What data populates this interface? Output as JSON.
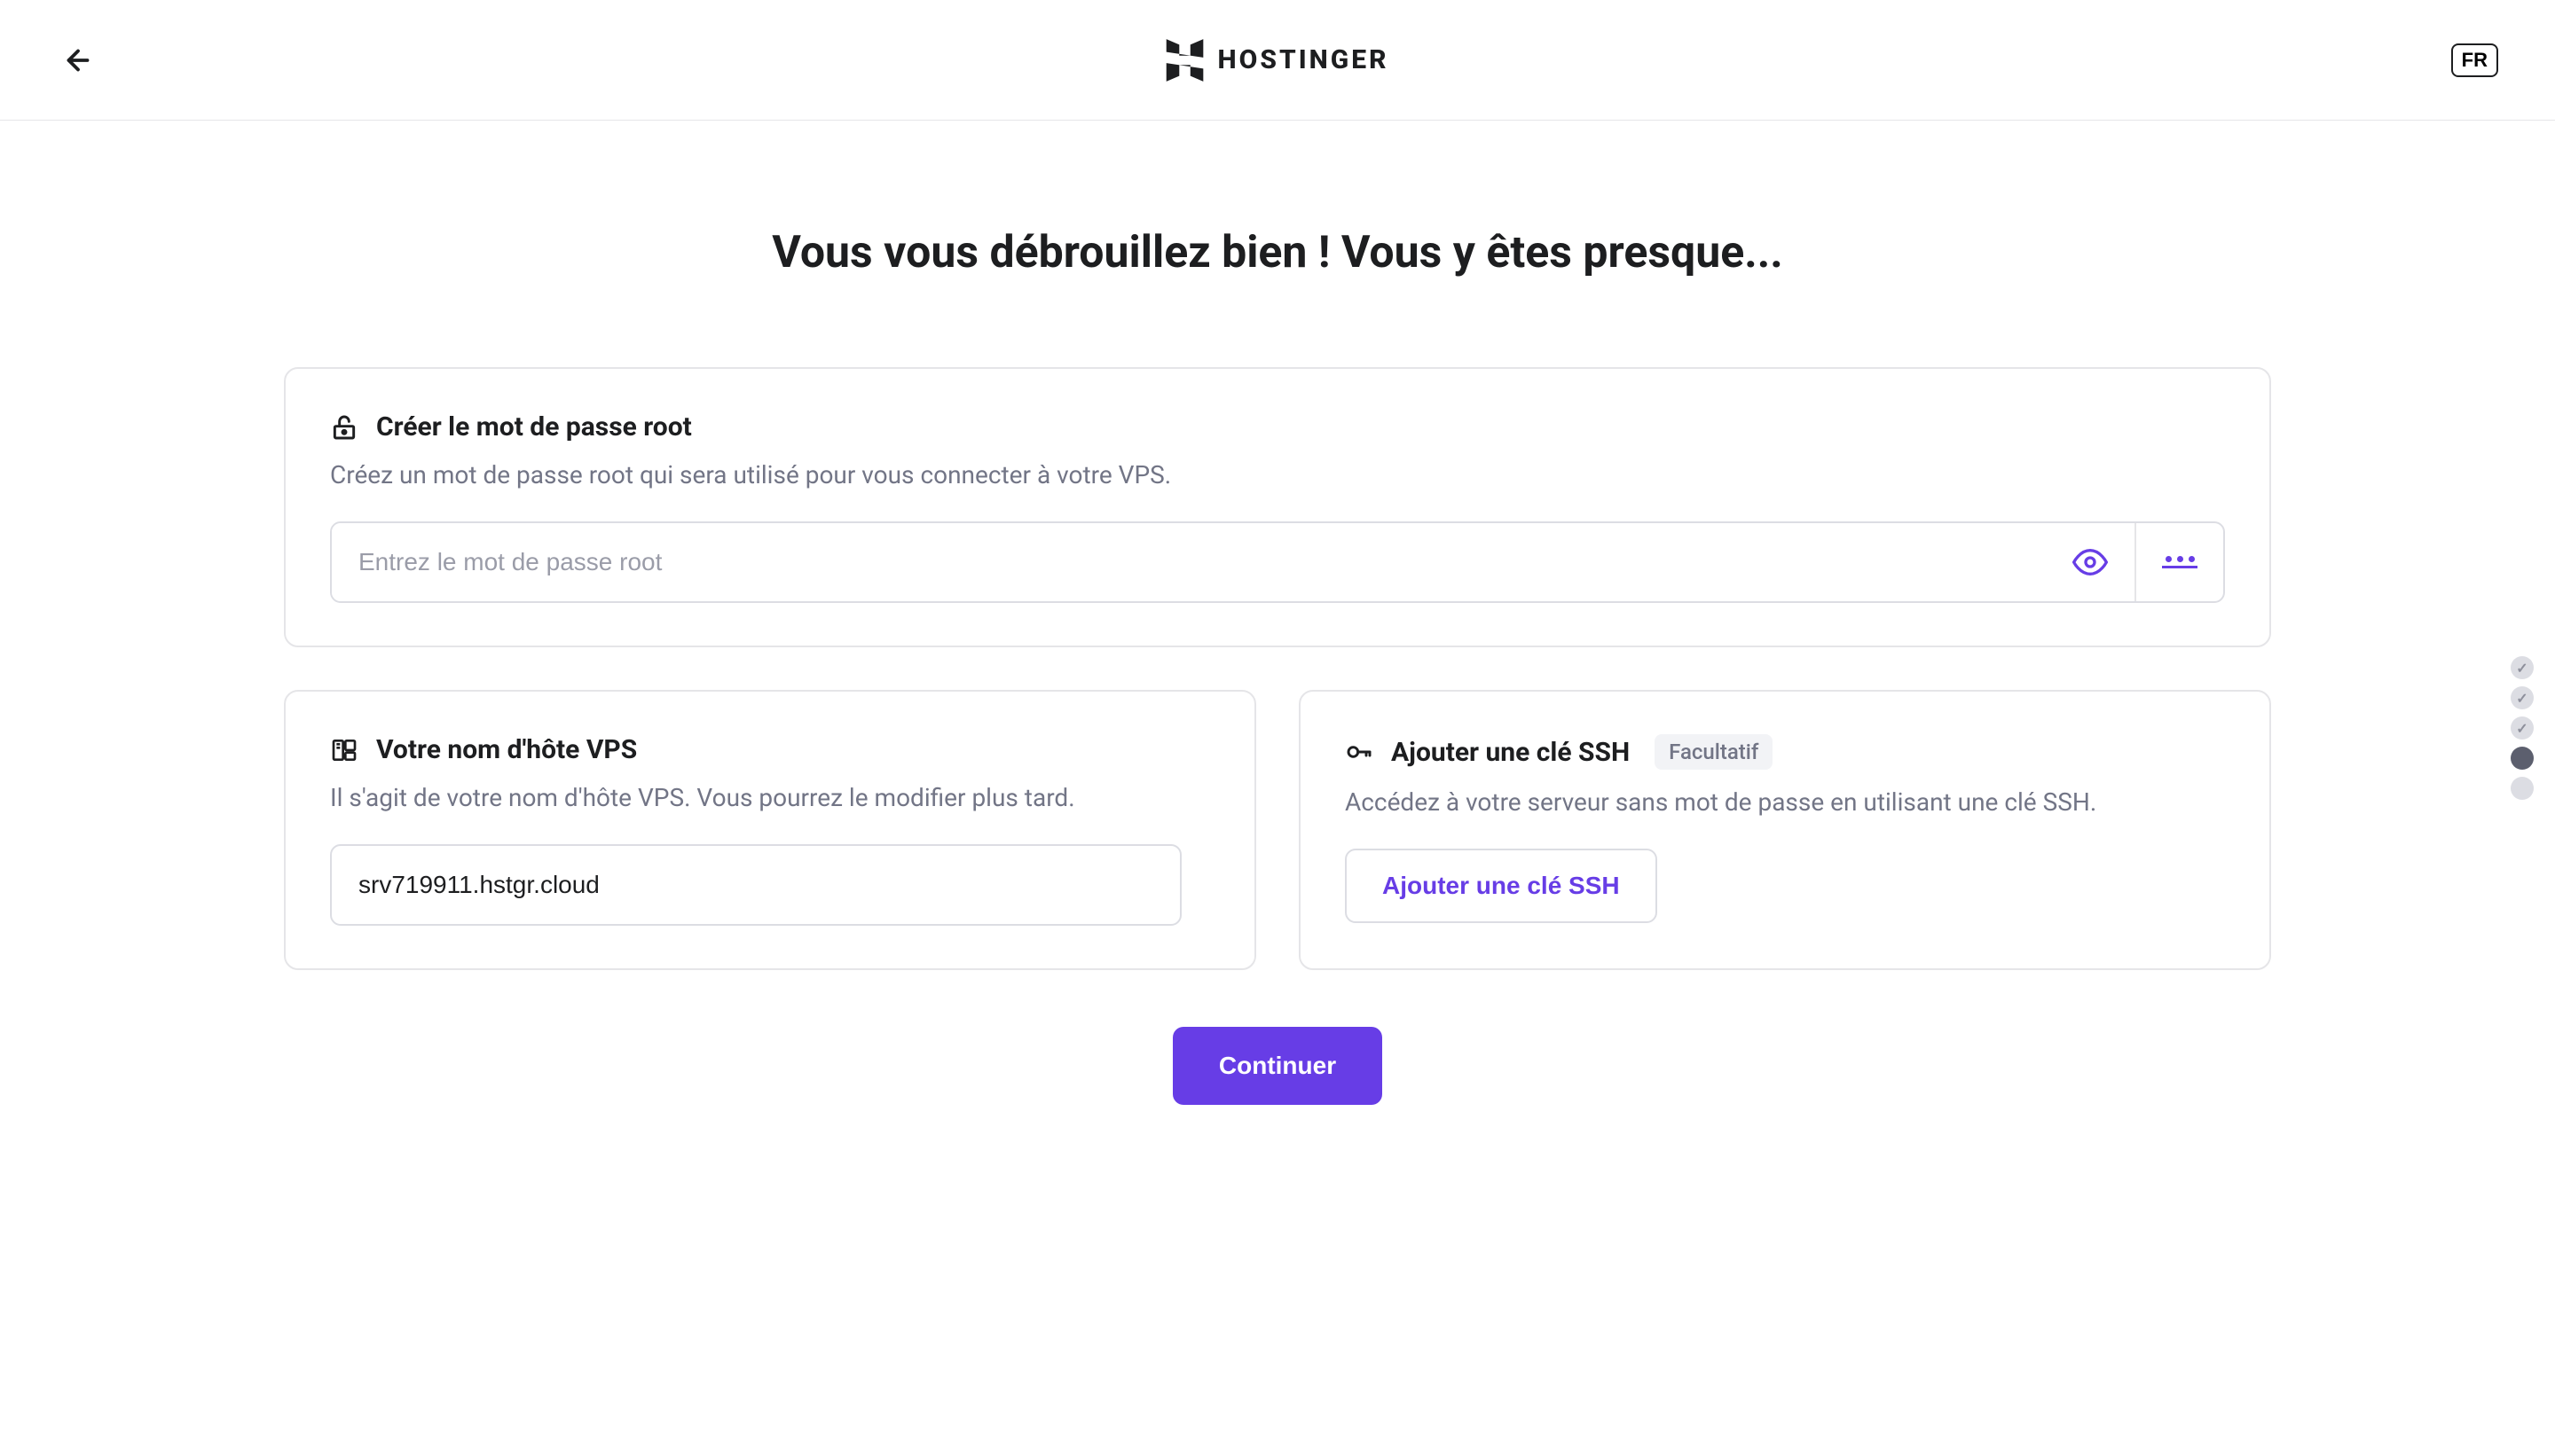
{
  "header": {
    "brand": "HOSTINGER",
    "language": "FR"
  },
  "page": {
    "title": "Vous vous débrouillez bien ! Vous y êtes presque..."
  },
  "root_password": {
    "title": "Créer le mot de passe root",
    "subtitle": "Créez un mot de passe root qui sera utilisé pour vous connecter à votre VPS.",
    "placeholder": "Entrez le mot de passe root"
  },
  "hostname": {
    "title": "Votre nom d'hôte VPS",
    "subtitle": "Il s'agit de votre nom d'hôte VPS. Vous pourrez le modifier plus tard.",
    "value": "srv719911.hstgr.cloud"
  },
  "ssh": {
    "title": "Ajouter une clé SSH",
    "optional": "Facultatif",
    "subtitle": "Accédez à votre serveur sans mot de passe en utilisant une clé SSH.",
    "button": "Ajouter une clé SSH"
  },
  "actions": {
    "continue": "Continuer"
  },
  "colors": {
    "primary": "#673de6",
    "text": "#1d1e20",
    "muted": "#727586",
    "border": "#e5e5e8"
  }
}
